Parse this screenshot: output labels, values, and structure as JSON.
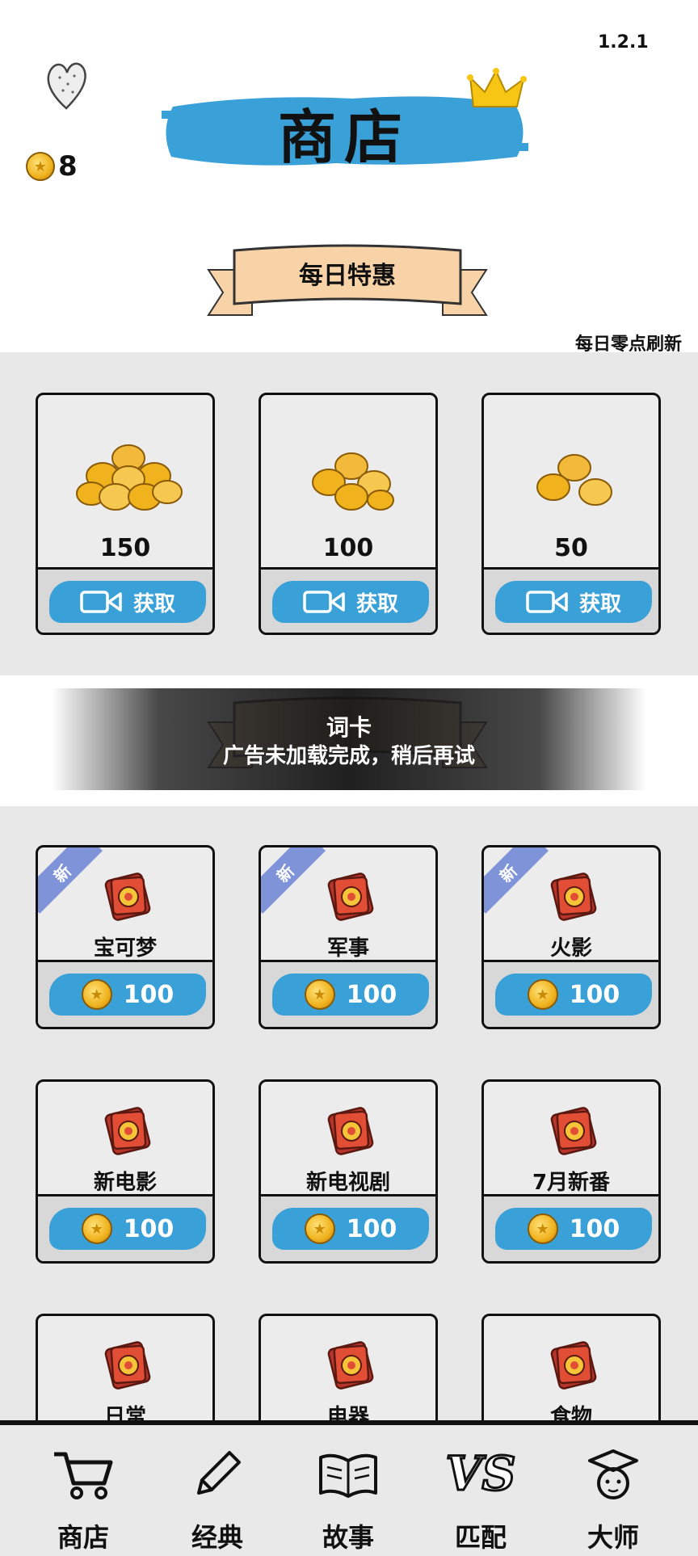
{
  "version": "1.2.1",
  "coins": "8",
  "title": "商店",
  "daily_section": {
    "title": "每日特惠",
    "refresh_note": "每日零点刷新",
    "items": [
      {
        "amount": "150",
        "action": "获取"
      },
      {
        "amount": "100",
        "action": "获取"
      },
      {
        "amount": "50",
        "action": "获取"
      }
    ]
  },
  "card_section": {
    "title": "词卡",
    "items": [
      {
        "name": "宝可梦",
        "price": "100",
        "badge": "新"
      },
      {
        "name": "军事",
        "price": "100",
        "badge": "新"
      },
      {
        "name": "火影",
        "price": "100",
        "badge": "新"
      },
      {
        "name": "新电影",
        "price": "100",
        "badge": ""
      },
      {
        "name": "新电视剧",
        "price": "100",
        "badge": ""
      },
      {
        "name": "7月新番",
        "price": "100",
        "badge": ""
      },
      {
        "name": "日常",
        "price": "",
        "badge": ""
      },
      {
        "name": "电器",
        "price": "",
        "badge": ""
      },
      {
        "name": "食物",
        "price": "",
        "badge": ""
      }
    ]
  },
  "toast": "广告未加载完成，稍后再试",
  "nav": [
    {
      "label": "商店",
      "icon": "cart-icon"
    },
    {
      "label": "经典",
      "icon": "pencil-icon"
    },
    {
      "label": "故事",
      "icon": "book-icon"
    },
    {
      "label": "匹配",
      "icon": "vs-icon"
    },
    {
      "label": "大师",
      "icon": "graduate-icon"
    }
  ],
  "colors": {
    "accent_blue": "#3aa0d8",
    "ribbon_peach": "#f8d3a8",
    "badge_purple": "#7e93d8",
    "coin_gold": "#f0b21d"
  }
}
